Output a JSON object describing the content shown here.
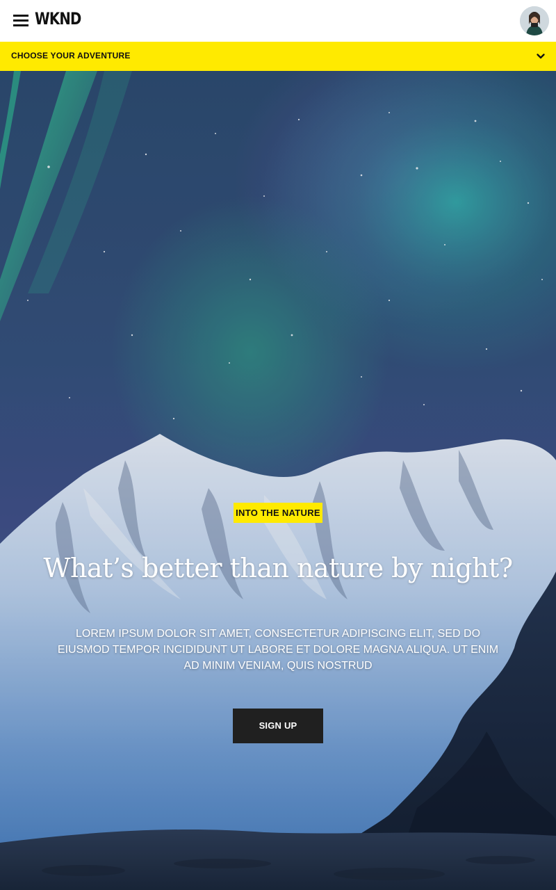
{
  "header": {
    "logo_text": "WKND",
    "menu_icon": "hamburger-menu-icon",
    "avatar_icon": "user-avatar"
  },
  "adventure_bar": {
    "label": "CHOOSE YOUR ADVENTURE",
    "chevron_icon": "chevron-down-icon",
    "background_color": "#ffea00"
  },
  "hero": {
    "tag": "INTO THE NATURE",
    "title": "What’s better than nature by night?",
    "description": "Lorem ipsum dolor sit amet, consectetur adipiscing elit, sed do eiusmod tempor incididunt ut labore et dolore magna aliqua. Ut enim ad minim veniam, quis nostrud",
    "cta_label": "SIGN UP",
    "image_subject": "aurora-over-snowy-mountains"
  },
  "colors": {
    "accent": "#ffea00",
    "button_dark": "#202020"
  }
}
